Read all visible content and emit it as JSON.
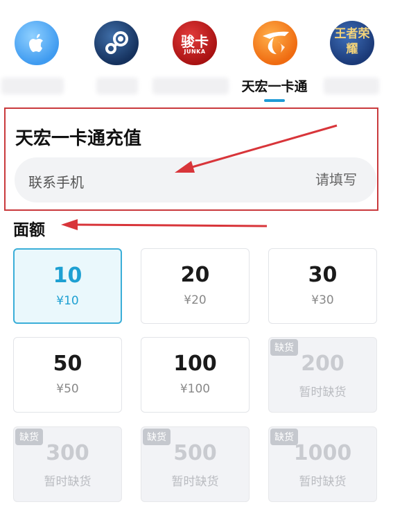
{
  "tabs": [
    {
      "id": "apple",
      "label": "",
      "icon": "apple-logo-icon",
      "active": false
    },
    {
      "id": "steam",
      "label": "",
      "icon": "steam-logo-icon",
      "active": false
    },
    {
      "id": "junka",
      "label": "",
      "icon": "junka-logo-icon",
      "logo_text": "骏卡",
      "logo_sub": "JUNKA",
      "active": false
    },
    {
      "id": "tianhong",
      "label": "天宏一卡通",
      "icon": "tianhong-logo-icon",
      "active": true
    },
    {
      "id": "wangzhe",
      "label": "",
      "icon": "wangzhe-logo-icon",
      "logo_text": "王者荣耀",
      "active": false
    }
  ],
  "recharge": {
    "title": "天宏一卡通充值",
    "phone_label": "联系手机",
    "phone_placeholder": "请填写",
    "phone_value": ""
  },
  "denominations_heading": "面额",
  "denominations": [
    {
      "amount": "10",
      "price": "¥10",
      "status": "selected"
    },
    {
      "amount": "20",
      "price": "¥20",
      "status": "available"
    },
    {
      "amount": "30",
      "price": "¥30",
      "status": "available"
    },
    {
      "amount": "50",
      "price": "¥50",
      "status": "available"
    },
    {
      "amount": "100",
      "price": "¥100",
      "status": "available"
    },
    {
      "amount": "200",
      "price": "暂时缺货",
      "status": "soldout",
      "badge": "缺货"
    },
    {
      "amount": "300",
      "price": "暂时缺货",
      "status": "soldout",
      "badge": "缺货"
    },
    {
      "amount": "500",
      "price": "暂时缺货",
      "status": "soldout",
      "badge": "缺货"
    },
    {
      "amount": "1000",
      "price": "暂时缺货",
      "status": "soldout",
      "badge": "缺货"
    }
  ],
  "colors": {
    "accent": "#1ea0d2",
    "annotation": "#d8353a",
    "soldout_text": "#c9cbd0"
  }
}
